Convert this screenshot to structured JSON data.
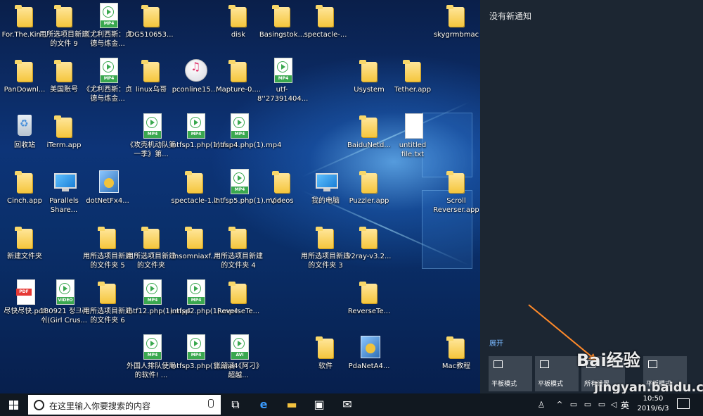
{
  "desktop": {
    "icons": [
      {
        "type": "folder",
        "label": "For.The.Kin..."
      },
      {
        "type": "folder",
        "label": "用所选项目新建的文件 9"
      },
      {
        "type": "mp4",
        "label": "《尤利西斯：贞德与炼金..."
      },
      {
        "type": "folder",
        "label": "DG510653..."
      },
      {
        "type": "folder",
        "label": "disk"
      },
      {
        "type": "folder",
        "label": "Basingstok..."
      },
      {
        "type": "folder",
        "label": "spectacle-..."
      },
      {
        "type": "folder",
        "label": "skygrmbmac"
      },
      {
        "type": "folder",
        "label": "PanDownl..."
      },
      {
        "type": "folder",
        "label": "美国账号"
      },
      {
        "type": "mp4",
        "label": "《尤利西斯：贞德与炼金..."
      },
      {
        "type": "folder",
        "label": "linux乌哥"
      },
      {
        "type": "itunes",
        "label": "pconline15..."
      },
      {
        "type": "folder",
        "label": "Mapture-0...."
      },
      {
        "type": "mp4",
        "label": "utf-8''27391404..."
      },
      {
        "type": "folder",
        "label": "Usystem"
      },
      {
        "type": "folder",
        "label": "Tether.app"
      },
      {
        "type": "recycle",
        "label": "回收站"
      },
      {
        "type": "folder",
        "label": "iTerm.app"
      },
      {
        "type": "mp4",
        "label": "《攻壳机动队第一季》第..."
      },
      {
        "type": "mp4",
        "label": "intfsp1.php(1).mp4"
      },
      {
        "type": "mp4",
        "label": "intfsp4.php(1).mp4"
      },
      {
        "type": "folder",
        "label": "BaiduNetd..."
      },
      {
        "type": "doc",
        "label": "untitled file.txt"
      },
      {
        "type": "folder",
        "label": "Cinch.app"
      },
      {
        "type": "pc",
        "label": "Parallels Share..."
      },
      {
        "type": "installer",
        "label": "dotNetFx4..."
      },
      {
        "type": "folder",
        "label": "spectacle-1.2"
      },
      {
        "type": "mp4",
        "label": "intfsp5.php(1).mp4"
      },
      {
        "type": "folder",
        "label": "Videos"
      },
      {
        "type": "pc",
        "label": "我的电脑"
      },
      {
        "type": "folder",
        "label": "Puzzler.app"
      },
      {
        "type": "folder",
        "label": "Scroll Reverser.app"
      },
      {
        "type": "folder",
        "label": "新建文件夹"
      },
      {
        "type": "folder",
        "label": "用所选项目新建的文件夹 5"
      },
      {
        "type": "folder",
        "label": "用所选项目新建的文件夹"
      },
      {
        "type": "folder",
        "label": "insomniaxf..."
      },
      {
        "type": "folder",
        "label": "用所选项目新建的文件夹 4"
      },
      {
        "type": "folder",
        "label": "用所选项目新建的文件夹 3"
      },
      {
        "type": "folder",
        "label": "v2ray-v3.2..."
      },
      {
        "type": "pdf",
        "label": "尽快尽快.pdf"
      },
      {
        "type": "video",
        "label": "180921 정크리쉬(Girl Crus..."
      },
      {
        "type": "folder",
        "label": "用所选项目新建的文件夹 6"
      },
      {
        "type": "mp4",
        "label": "intf12.php(1).mp4"
      },
      {
        "type": "mp4",
        "label": "intfsp2.php(1).mp4"
      },
      {
        "type": "folder",
        "label": "ReverseTe..."
      },
      {
        "type": "folder",
        "label": "ReverseTe..."
      },
      {
        "type": "mp4",
        "label": "外国人排队使用的软件! ..."
      },
      {
        "type": "mp4",
        "label": "intfsp3.php(1).mp4"
      },
      {
        "type": "avi",
        "label": "张韶涵《阿刁》超越..."
      },
      {
        "type": "folder",
        "label": "软件"
      },
      {
        "type": "installer",
        "label": "PdaNetA4..."
      },
      {
        "type": "folder",
        "label": "Mac教程"
      }
    ]
  },
  "action_center": {
    "title": "没有新通知",
    "expand_label": "展开",
    "tiles": [
      {
        "label": "平板模式"
      },
      {
        "label": "平板模式"
      },
      {
        "label": "所有设置"
      },
      {
        "label": "平板模式"
      }
    ]
  },
  "watermark": {
    "logo_text": "Bai经验",
    "url_text": "jingyan.baidu.co"
  },
  "taskbar": {
    "search_placeholder": "在这里输入你要搜索的内容",
    "apps": [
      "task-view-icon",
      "edge-icon",
      "file-explorer-icon",
      "store-icon",
      "mail-icon"
    ],
    "ime_label": "英",
    "time": "10:50",
    "date": "2019/6/3"
  },
  "colors": {
    "desktop_bg": "#0d3478",
    "action_center_bg": "#1c2632",
    "taskbar_bg": "#111820",
    "accent_link": "#79b8ff"
  }
}
